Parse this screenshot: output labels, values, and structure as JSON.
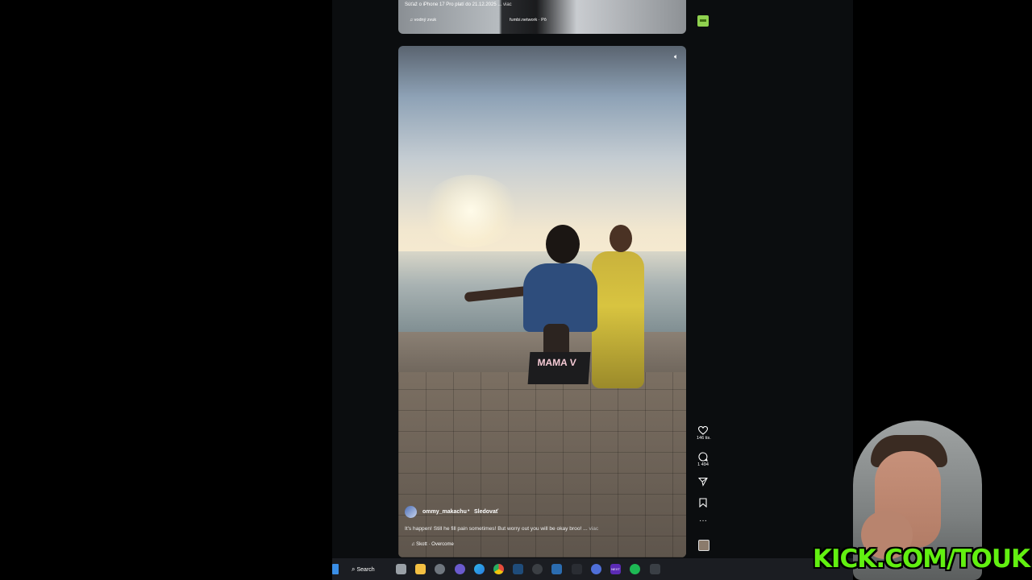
{
  "previous_reel": {
    "caption": "Súťaž o iPhone 17 Pro platí do 21.12.2025 ...",
    "caption_more": "viac",
    "audio": "vodný zvuk",
    "credit": "fumbi.network · Pô"
  },
  "reel": {
    "sign_text": "MAMA V",
    "username": "ommy_makachu",
    "separator": "•",
    "follow_label": "Sledovať",
    "caption": "It's happen! Still he fill pain sometimes! But worry out you will be okay broo! ...",
    "caption_more": "viac",
    "audio": "Skott · Overcome",
    "likes": "146 tis.",
    "comments": "1 494"
  },
  "taskbar": {
    "search_label": "Search",
    "next_label": "NEXT"
  },
  "overlay": {
    "brand_text": "KICK.COM/TOUKEN"
  }
}
